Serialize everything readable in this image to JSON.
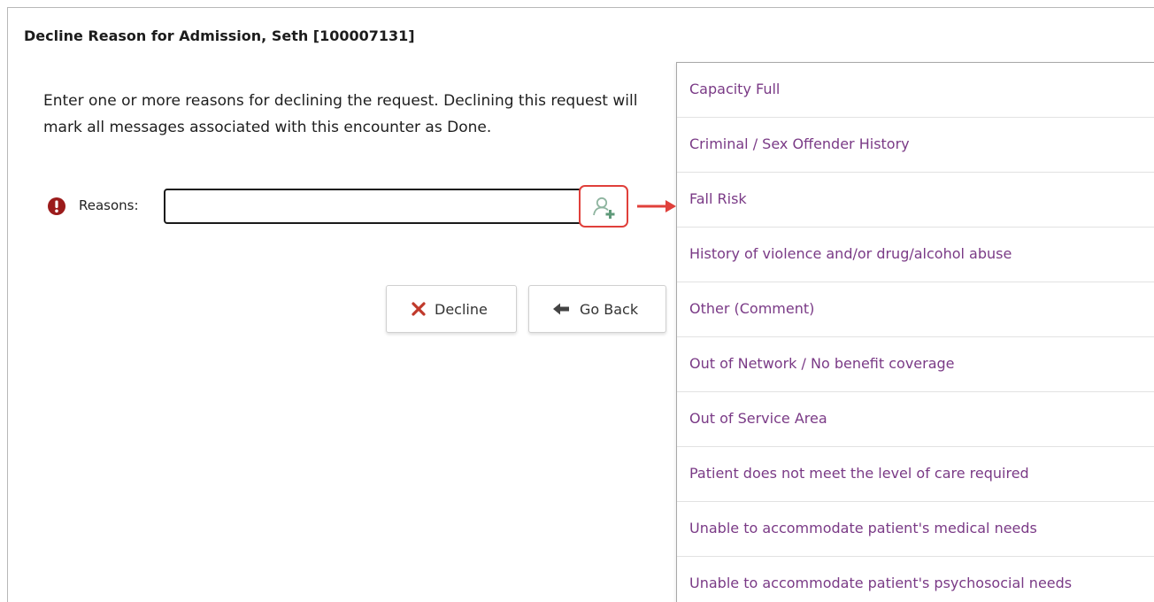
{
  "dialog": {
    "title": "Decline Reason for Admission, Seth [100007131]",
    "instructions": "Enter one or more reasons for declining the request. Declining this request will mark all messages associated with this encounter as Done."
  },
  "reasons": {
    "label": "Reasons:",
    "value": "",
    "required_icon": "exclamation-circle-icon",
    "lookup_icon": "person-add-icon"
  },
  "buttons": {
    "decline_label": "Decline",
    "decline_icon": "x-icon",
    "go_back_label": "Go Back",
    "go_back_icon": "arrow-left-icon"
  },
  "dropdown": {
    "items": [
      "Capacity Full",
      "Criminal / Sex Offender History",
      "Fall Risk",
      "History of violence and/or drug/alcohol abuse",
      "Other (Comment)",
      "Out of Network / No benefit coverage",
      "Out of Service Area",
      "Patient does not meet the level of care required",
      "Unable to accommodate patient's medical needs",
      "Unable to accommodate patient's psychosocial needs"
    ]
  },
  "colors": {
    "required": "#9b1b1b",
    "highlight": "#e0403b",
    "item_text": "#7a3a86",
    "decline_icon": "#c0392b",
    "lookup_icon": "#6f9e86"
  }
}
